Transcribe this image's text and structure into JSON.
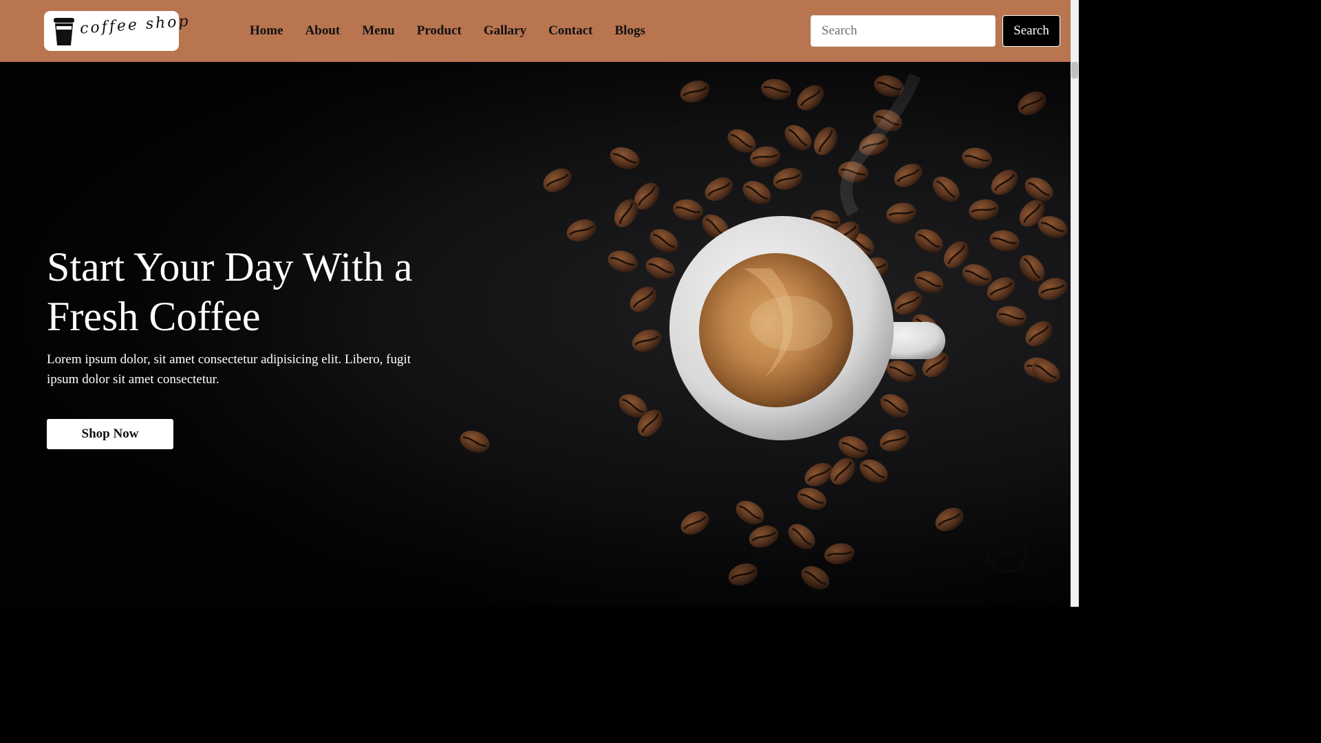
{
  "brand": {
    "logo_text": "coffee shop"
  },
  "nav": {
    "links": [
      "Home",
      "About",
      "Menu",
      "Product",
      "Gallary",
      "Contact",
      "Blogs"
    ]
  },
  "search": {
    "placeholder": "Search",
    "button_label": "Search"
  },
  "hero": {
    "title": "Start Your Day With a Fresh Coffee",
    "text": "Lorem ipsum dolor, sit amet consectetur adipisicing elit. Libero, fugit ipsum dolor sit amet consectetur.",
    "cta_label": "Shop Now"
  },
  "colors": {
    "navbar": "#b87550",
    "hero_bg": "#0a0a0b",
    "bean": "#5a3520",
    "crema": "#c58b50"
  },
  "icons": {
    "logo": "coffee-cup-icon",
    "scroll_top": "chevron-up-icon"
  }
}
